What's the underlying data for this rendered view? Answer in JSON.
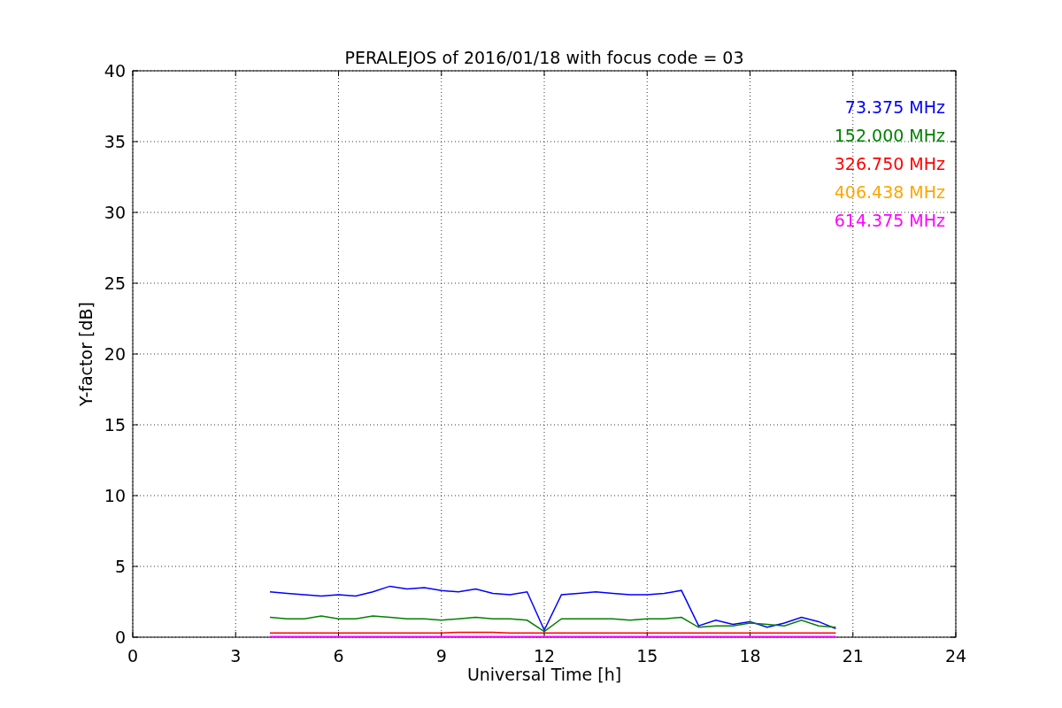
{
  "figure": {
    "chart_data": {
      "type": "line",
      "title": "PERALEJOS of 2016/01/18 with focus code = 03",
      "xlabel": "Universal Time [h]",
      "ylabel": "Y-factor [dB]",
      "x": [
        4,
        4.5,
        5,
        5.5,
        6,
        6.5,
        7,
        7.5,
        8,
        8.5,
        9,
        9.5,
        10,
        10.5,
        11,
        11.5,
        12,
        12.5,
        13,
        13.5,
        14,
        14.5,
        15,
        15.5,
        16,
        16.5,
        17,
        17.5,
        18,
        18.5,
        19,
        19.5,
        20,
        20.5
      ],
      "series": [
        {
          "name": "73.375 MHz",
          "color": "#0000ff",
          "values": [
            3.2,
            3.1,
            3.0,
            2.9,
            3.0,
            2.9,
            3.2,
            3.6,
            3.4,
            3.5,
            3.3,
            3.2,
            3.4,
            3.1,
            3.0,
            3.2,
            0.5,
            3.0,
            3.1,
            3.2,
            3.1,
            3.0,
            3.0,
            3.1,
            3.3,
            0.8,
            1.2,
            0.9,
            1.1,
            0.7,
            1.0,
            1.4,
            1.1,
            0.6
          ]
        },
        {
          "name": "152.000 MHz",
          "color": "#008000",
          "values": [
            1.4,
            1.3,
            1.3,
            1.5,
            1.3,
            1.3,
            1.5,
            1.4,
            1.3,
            1.3,
            1.2,
            1.3,
            1.4,
            1.3,
            1.3,
            1.2,
            0.4,
            1.3,
            1.3,
            1.3,
            1.3,
            1.2,
            1.3,
            1.3,
            1.4,
            0.7,
            0.8,
            0.8,
            1.0,
            0.9,
            0.8,
            1.2,
            0.8,
            0.7
          ]
        },
        {
          "name": "326.750 MHz",
          "color": "#ff0000",
          "values": [
            0.3,
            0.3,
            0.3,
            0.3,
            0.3,
            0.3,
            0.3,
            0.3,
            0.3,
            0.3,
            0.3,
            0.35,
            0.35,
            0.35,
            0.3,
            0.3,
            0.3,
            0.3,
            0.3,
            0.3,
            0.3,
            0.3,
            0.3,
            0.3,
            0.3,
            0.3,
            0.3,
            0.3,
            0.3,
            0.3,
            0.3,
            0.3,
            0.3,
            0.3
          ]
        },
        {
          "name": "406.438 MHz",
          "color": "#ffa500",
          "values": [
            null,
            null,
            null,
            null,
            null,
            null,
            null,
            null,
            null,
            null,
            null,
            null,
            null,
            null,
            null,
            null,
            null,
            null,
            null,
            null,
            null,
            null,
            null,
            null,
            null,
            null,
            null,
            null,
            null,
            null,
            null,
            null,
            null,
            null
          ]
        },
        {
          "name": "614.375 MHz",
          "color": "#ff00ff",
          "values": [
            0.05,
            0.05,
            0.05,
            0.05,
            0.05,
            0.05,
            0.05,
            0.05,
            0.05,
            0.05,
            0.05,
            0.05,
            0.05,
            0.05,
            0.05,
            0.05,
            0.05,
            0.05,
            0.05,
            0.05,
            0.05,
            0.05,
            0.05,
            0.05,
            0.05,
            0.05,
            0.05,
            0.05,
            0.05,
            0.05,
            0.05,
            0.05,
            0.05,
            0.05
          ]
        }
      ],
      "grid": true,
      "xlim": [
        0,
        24
      ],
      "ylim": [
        0,
        40
      ],
      "xticks": [
        0,
        3,
        6,
        9,
        12,
        15,
        18,
        21,
        24
      ],
      "yticks": [
        0,
        5,
        10,
        15,
        20,
        25,
        30,
        35,
        40
      ]
    }
  }
}
